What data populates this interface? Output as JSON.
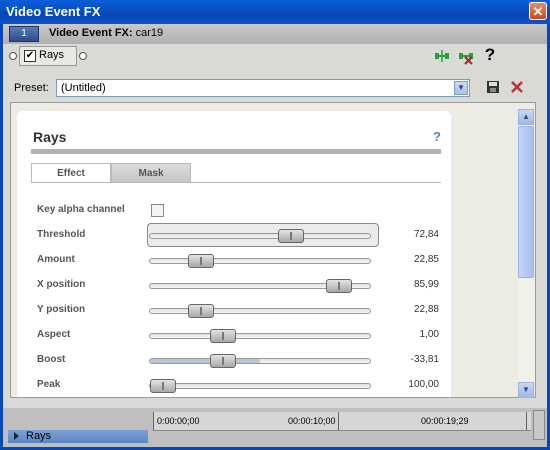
{
  "window": {
    "title": "Video Event FX",
    "close_glyph": "✕"
  },
  "header": {
    "number": "1",
    "label_bold": "Video Event FX:",
    "label_rest": " car19"
  },
  "chain": {
    "fx_name": "Rays",
    "checked": true
  },
  "preset": {
    "label": "Preset:",
    "value": "(Untitled)"
  },
  "panel": {
    "title": "Rays",
    "help": "?",
    "tabs": [
      {
        "label": "Effect",
        "active": true
      },
      {
        "label": "Mask",
        "active": false
      }
    ],
    "params": [
      {
        "label": "Key alpha channel",
        "kind": "checkbox",
        "checked": false,
        "value": ""
      },
      {
        "label": "Threshold",
        "kind": "slider",
        "position": 0.64,
        "fill": 0.0,
        "value": "72,84",
        "highlight": true
      },
      {
        "label": "Amount",
        "kind": "slider",
        "position": 0.23,
        "fill": 0.0,
        "value": "22,85"
      },
      {
        "label": "X position",
        "kind": "slider",
        "position": 0.86,
        "fill": 0.0,
        "value": "85,99"
      },
      {
        "label": "Y position",
        "kind": "slider",
        "position": 0.23,
        "fill": 0.0,
        "value": "22,88"
      },
      {
        "label": "Aspect",
        "kind": "slider",
        "position": 0.33,
        "fill": 0.0,
        "value": "1,00"
      },
      {
        "label": "Boost",
        "kind": "slider",
        "position": 0.33,
        "fill": 0.5,
        "value": "-33,81"
      },
      {
        "label": "Peak",
        "kind": "slider",
        "position": 0.0,
        "fill": 0.0,
        "value": "100,00"
      }
    ]
  },
  "timeline": {
    "track_label": "Rays",
    "ruler": [
      "0:00:00;00",
      "00:00:10;00",
      "00:00:19;29"
    ]
  },
  "icons": {
    "close": "close-icon",
    "dropdown": "chevron-down-icon",
    "save": "save-icon",
    "delete": "delete-icon",
    "help": "help-icon"
  }
}
